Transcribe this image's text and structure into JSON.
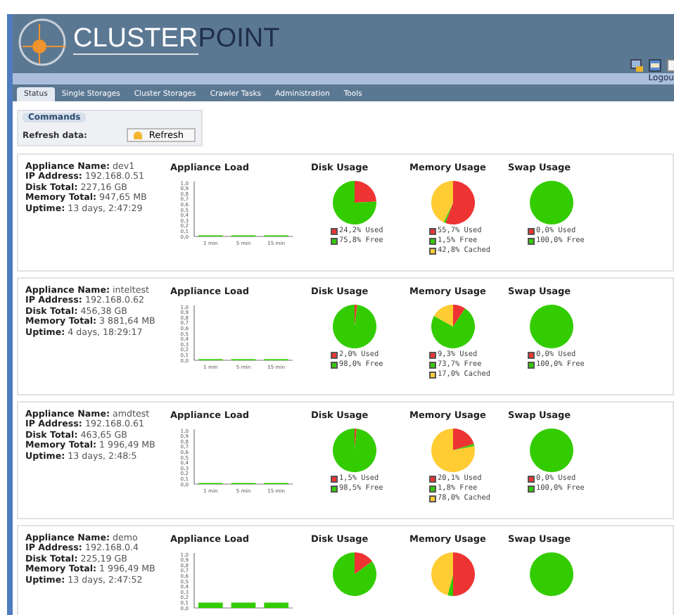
{
  "header": {
    "logo_part_1": "CLUSTER",
    "logo_part_2": "POINT",
    "logout": "Logou"
  },
  "tabs": [
    {
      "label": "Status",
      "selected": true
    },
    {
      "label": "Single Storages",
      "selected": false
    },
    {
      "label": "Cluster Storages",
      "selected": false
    },
    {
      "label": "Crawler Tasks",
      "selected": false
    },
    {
      "label": "Administration",
      "selected": false
    },
    {
      "label": "Tools",
      "selected": false
    }
  ],
  "commands": {
    "title": "Commands",
    "label": "Refresh data:",
    "button": "Refresh"
  },
  "appliances": [
    {
      "info": [
        "**Appliance Name:** dev1",
        "**IP Address:** 192.168.0.51",
        "**Disk Total:** 227,16 GB",
        "**Memory Total:** 947,65 MB",
        "**Uptime:** 13 days, 2:47:29"
      ],
      "load": {
        "chart_data": {
          "type": "bar",
          "title": "Appliance Load",
          "categories": [
            "1 min",
            "5 min",
            "15 min"
          ],
          "values": [
            0.02,
            0.02,
            0.02
          ],
          "ylim": [
            0,
            1
          ],
          "yticks": [
            {
              "value": 0,
              "label": "0,0"
            },
            {
              "value": 0.1,
              "label": "0,1"
            },
            {
              "value": 0.2,
              "label": "0,2"
            },
            {
              "value": 0.3,
              "label": "0,3"
            },
            {
              "value": 0.4,
              "label": "0,4"
            },
            {
              "value": 0.5,
              "label": "0,5"
            },
            {
              "value": 0.6,
              "label": "0,6"
            },
            {
              "value": 0.7,
              "label": "0,7"
            },
            {
              "value": 0.8,
              "label": "0,8"
            },
            {
              "value": 0.9,
              "label": "0,9"
            },
            {
              "value": 1,
              "label": "1,0"
            }
          ]
        }
      },
      "pies": [
        {
          "chart_data": {
            "type": "pie",
            "title": "Disk Usage",
            "categories": [
              "24,2% Used",
              "75,8% Free"
            ],
            "values": [
              24.2,
              75.8
            ]
          }
        },
        {
          "chart_data": {
            "type": "pie",
            "title": "Memory Usage",
            "categories": [
              "55,7% Used",
              "1,5% Free",
              "42,8% Cached"
            ],
            "values": [
              55.7,
              1.5,
              42.8
            ]
          }
        },
        {
          "chart_data": {
            "type": "pie",
            "title": "Swap Usage",
            "categories": [
              "0,0% Used",
              "100,0% Free"
            ],
            "values": [
              0,
              100
            ]
          }
        }
      ]
    },
    {
      "info": [
        "**Appliance Name:** inteltest",
        "**IP Address:** 192.168.0.62",
        "**Disk Total:** 456,38 GB",
        "**Memory Total:** 3 881,64 MB",
        "**Uptime:** 4 days, 18:29:17"
      ],
      "load": {
        "chart_data": {
          "type": "bar",
          "title": "Appliance Load",
          "categories": [
            "1 min",
            "5 min",
            "15 min"
          ],
          "values": [
            0.01,
            0.01,
            0.01
          ],
          "ylim": [
            0,
            1
          ],
          "yticks": [
            {
              "value": 0,
              "label": "0,0"
            },
            {
              "value": 0.1,
              "label": "0,1"
            },
            {
              "value": 0.2,
              "label": "0,2"
            },
            {
              "value": 0.3,
              "label": "0,3"
            },
            {
              "value": 0.4,
              "label": "0,4"
            },
            {
              "value": 0.5,
              "label": "0,5"
            },
            {
              "value": 0.6,
              "label": "0,6"
            },
            {
              "value": 0.7,
              "label": "0,7"
            },
            {
              "value": 0.8,
              "label": "0,8"
            },
            {
              "value": 0.9,
              "label": "0,9"
            },
            {
              "value": 1,
              "label": "1,0"
            }
          ]
        }
      },
      "pies": [
        {
          "chart_data": {
            "type": "pie",
            "title": "Disk Usage",
            "categories": [
              "2,0% Used",
              "98,0% Free"
            ],
            "values": [
              2.0,
              98.0
            ]
          }
        },
        {
          "chart_data": {
            "type": "pie",
            "title": "Memory Usage",
            "categories": [
              "9,3% Used",
              "73,7% Free",
              "17,0% Cached"
            ],
            "values": [
              9.3,
              73.7,
              17.0
            ]
          }
        },
        {
          "chart_data": {
            "type": "pie",
            "title": "Swap Usage",
            "categories": [
              "0,0% Used",
              "100,0% Free"
            ],
            "values": [
              0,
              100
            ]
          }
        }
      ]
    },
    {
      "info": [
        "**Appliance Name:** amdtest",
        "**IP Address:** 192.168.0.61",
        "**Disk Total:** 463,65 GB",
        "**Memory Total:** 1 996,49 MB",
        "**Uptime:** 13 days, 2:48:5"
      ],
      "load": {
        "chart_data": {
          "type": "bar",
          "title": "Appliance Load",
          "categories": [
            "1 min",
            "5 min",
            "15 min"
          ],
          "values": [
            0.01,
            0.01,
            0.01
          ],
          "ylim": [
            0,
            1
          ],
          "yticks": [
            {
              "value": 0,
              "label": "0,0"
            },
            {
              "value": 0.1,
              "label": "0,1"
            },
            {
              "value": 0.2,
              "label": "0,2"
            },
            {
              "value": 0.3,
              "label": "0,3"
            },
            {
              "value": 0.4,
              "label": "0,4"
            },
            {
              "value": 0.5,
              "label": "0,5"
            },
            {
              "value": 0.6,
              "label": "0,6"
            },
            {
              "value": 0.7,
              "label": "0,7"
            },
            {
              "value": 0.8,
              "label": "0,8"
            },
            {
              "value": 0.9,
              "label": "0,9"
            },
            {
              "value": 1,
              "label": "1,0"
            }
          ]
        }
      },
      "pies": [
        {
          "chart_data": {
            "type": "pie",
            "title": "Disk Usage",
            "categories": [
              "1,5% Used",
              "98,5% Free"
            ],
            "values": [
              1.5,
              98.5
            ]
          }
        },
        {
          "chart_data": {
            "type": "pie",
            "title": "Memory Usage",
            "categories": [
              "20,1% Used",
              "1,8% Free",
              "78,0% Cached"
            ],
            "values": [
              20.1,
              1.8,
              78.0
            ]
          }
        },
        {
          "chart_data": {
            "type": "pie",
            "title": "Swap Usage",
            "categories": [
              "0,0% Used",
              "100,0% Free"
            ],
            "values": [
              0,
              100
            ]
          }
        }
      ]
    },
    {
      "info": [
        "**Appliance Name:** demo",
        "**IP Address:** 192.168.0.4",
        "**Disk Total:** 225,19 GB",
        "**Memory Total:** 1 996,49 MB",
        "**Uptime:** 13 days, 2:47:52"
      ],
      "load": {
        "chart_data": {
          "type": "bar",
          "title": "Appliance Load",
          "values": [
            0.1,
            0.1,
            0.1
          ],
          "ylim": [
            0,
            1
          ],
          "yticks": [
            {
              "value": 0,
              "label": "0,0"
            },
            {
              "value": 0.1,
              "label": "0,1"
            },
            {
              "value": 0.2,
              "label": "0,2"
            },
            {
              "value": 0.3,
              "label": "0,3"
            },
            {
              "value": 0.4,
              "label": "0,4"
            },
            {
              "value": 0.5,
              "label": "0,5"
            },
            {
              "value": 0.6,
              "label": "0,6"
            },
            {
              "value": 0.7,
              "label": "0,7"
            },
            {
              "value": 0.8,
              "label": "0,8"
            },
            {
              "value": 0.9,
              "label": "0,9"
            },
            {
              "value": 1,
              "label": "1,0"
            }
          ]
        }
      },
      "pies": [
        {
          "chart_data": {
            "type": "pie",
            "title": "Disk Usage",
            "values": [
              15,
              85
            ]
          }
        },
        {
          "chart_data": {
            "type": "pie",
            "title": "Memory Usage",
            "values": [
              50,
              4,
              46
            ]
          }
        },
        {
          "chart_data": {
            "type": "pie",
            "title": "Swap Usage",
            "values": [
              0,
              100
            ]
          }
        }
      ]
    }
  ]
}
